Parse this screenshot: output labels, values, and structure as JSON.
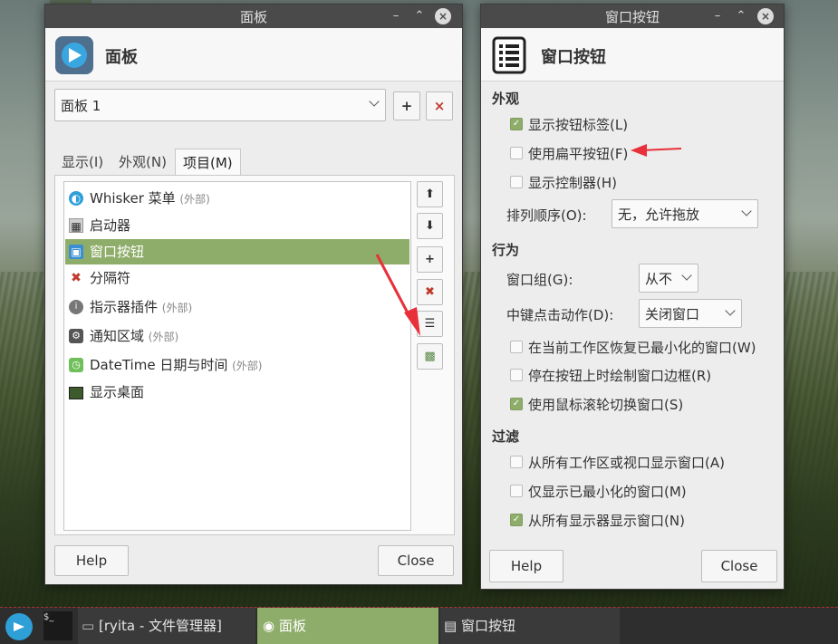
{
  "panel_window": {
    "title": "面板",
    "header_title": "面板",
    "panel_select": "面板 1",
    "add_label": "+",
    "remove_label": "×",
    "tabs": [
      {
        "label": "显示(I)",
        "active": false
      },
      {
        "label": "外观(N)",
        "active": false
      },
      {
        "label": "项目(M)",
        "active": true
      }
    ],
    "items": [
      {
        "icon": "whisker-icon",
        "label": "Whisker 菜单",
        "note": "(外部)",
        "selected": false
      },
      {
        "icon": "launcher-icon",
        "label": "启动器",
        "note": "",
        "selected": false
      },
      {
        "icon": "window-buttons-icon",
        "label": "窗口按钮",
        "note": "",
        "selected": true
      },
      {
        "icon": "separator-icon",
        "label": "分隔符",
        "note": "",
        "selected": false
      },
      {
        "icon": "indicator-icon",
        "label": "指示器插件",
        "note": "(外部)",
        "selected": false
      },
      {
        "icon": "notification-icon",
        "label": "通知区域",
        "note": "(外部)",
        "selected": false
      },
      {
        "icon": "clock-icon",
        "label": "DateTime 日期与时间",
        "note": "(外部)",
        "selected": false
      },
      {
        "icon": "show-desktop-icon",
        "label": "显示桌面",
        "note": "",
        "selected": false
      }
    ],
    "help_label": "Help",
    "close_label": "Close"
  },
  "prefs_window": {
    "title": "窗口按钮",
    "header_title": "窗口按钮",
    "appearance": {
      "heading": "外观",
      "show_labels": {
        "label": "显示按钮标签(L)",
        "checked": true
      },
      "flat_buttons": {
        "label": "使用扁平按钮(F)",
        "checked": false
      },
      "show_handle": {
        "label": "显示控制器(H)",
        "checked": false
      },
      "sort_label": "排列顺序(O):",
      "sort_value": "无，允许拖放"
    },
    "behaviour": {
      "heading": "行为",
      "group_label": "窗口组(G):",
      "group_value": "从不",
      "middle_label": "中键点击动作(D):",
      "middle_value": "关闭窗口",
      "restore_min": {
        "label": "在当前工作区恢复已最小化的窗口(W)",
        "checked": false
      },
      "draw_frame": {
        "label": "停在按钮上时绘制窗口边框(R)",
        "checked": false
      },
      "scroll_switch": {
        "label": "使用鼠标滚轮切换窗口(S)",
        "checked": true
      }
    },
    "filtering": {
      "heading": "过滤",
      "all_workspaces": {
        "label": "从所有工作区或视口显示窗口(A)",
        "checked": false
      },
      "only_min": {
        "label": "仅显示已最小化的窗口(M)",
        "checked": false
      },
      "all_monitors": {
        "label": "从所有显示器显示窗口(N)",
        "checked": true
      }
    },
    "help_label": "Help",
    "close_label": "Close"
  },
  "taskbar": {
    "tasks": [
      {
        "label": "[ryita - 文件管理器]",
        "active": false
      },
      {
        "label": "面板",
        "active": true
      },
      {
        "label": "窗口按钮",
        "active": false
      }
    ]
  },
  "colors": {
    "accent": "#8fad6a",
    "titlebar": "#4a4a4a",
    "annotation_arrow": "#e8303a"
  }
}
